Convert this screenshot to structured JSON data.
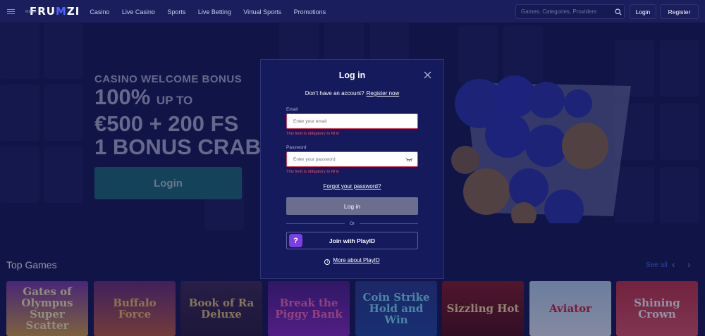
{
  "header": {
    "menu_label": "MENU",
    "logo": "FRUMZI",
    "nav": [
      "Casino",
      "Live Casino",
      "Sports",
      "Live Betting",
      "Virtual Sports",
      "Promotions"
    ],
    "search_placeholder": "Games, Categories, Providers",
    "login_label": "Login",
    "register_label": "Register"
  },
  "hero": {
    "line1": "CASINO WELCOME BONUS",
    "line2_main": "100%",
    "line2_small": "UP TO",
    "line3": "€500 + 200 FS",
    "line4": "1 BONUS CRAB",
    "cta": "Login"
  },
  "top_games": {
    "title": "Top Games",
    "see_all": "See all",
    "games": [
      "Gates of Olympus Super Scatter",
      "Buffalo Force",
      "Book of Ra Deluxe",
      "Break the Piggy Bank",
      "Coin Strike Hold and Win",
      "Sizzling Hot",
      "Aviator",
      "Shining Crown"
    ]
  },
  "modal": {
    "title": "Log in",
    "no_account": "Don't have an account?",
    "register_link": "Register now",
    "email_label": "Email",
    "email_placeholder": "Enter your email",
    "email_error": "This field is obligatory to fill in",
    "password_label": "Password",
    "password_placeholder": "Enter your password",
    "password_error": "This field is obligatory to fill in",
    "forgot": "Forgot your password?",
    "login_button": "Log in",
    "or": "Or",
    "playid_button": "Join with PlayID",
    "more_playid": "More about PlayID"
  },
  "colors": {
    "background": "#141850",
    "modal": "#141a5c",
    "accent_link": "#4d6cf0",
    "error": "#ff4f6b",
    "hero_cta": "#1a6c76"
  }
}
